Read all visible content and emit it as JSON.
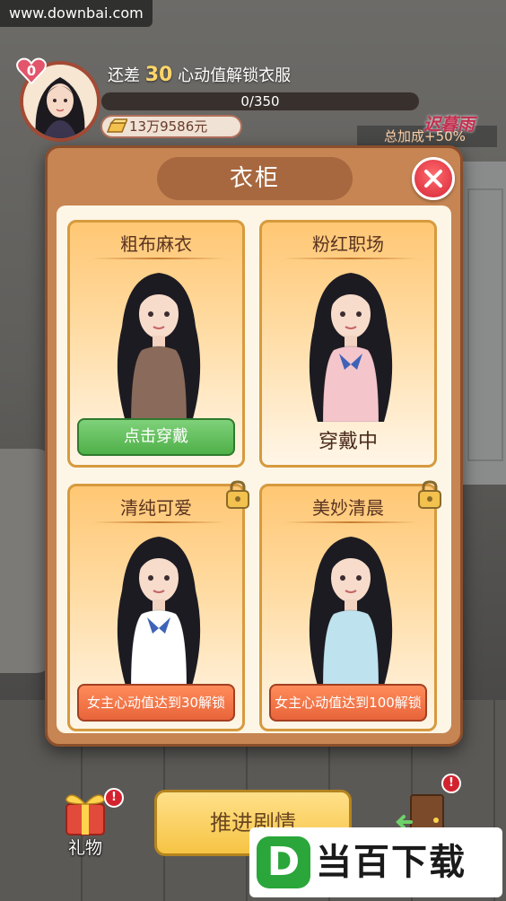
{
  "watermark_top": "www.downbai.com",
  "header": {
    "heart_level": "0",
    "unlock_prefix": "还差",
    "unlock_points": "30",
    "unlock_suffix": "心动值解锁衣服",
    "progress_text": "0/350",
    "progress_value": 0,
    "progress_max": 350,
    "money": "13万9586元",
    "character_name": "迟暮雨",
    "bonus_text": "总加成+50%"
  },
  "modal": {
    "title": "衣柜",
    "close_icon": "close-icon",
    "outfits": [
      {
        "title": "粗布麻衣",
        "status": "available",
        "button_label": "点击穿戴",
        "dress_color": "#8a6b5b"
      },
      {
        "title": "粉红职场",
        "status": "wearing",
        "status_label": "穿戴中",
        "dress_color": "#f4c6cb"
      },
      {
        "title": "清纯可爱",
        "status": "locked",
        "lock_label": "女主心动值达到30解锁",
        "dress_color": "#ffffff"
      },
      {
        "title": "美妙清晨",
        "status": "locked",
        "lock_label": "女主心动值达到100解锁",
        "dress_color": "#bfe3ee"
      }
    ]
  },
  "bottom": {
    "gift_label": "礼物",
    "gift_badge": "!",
    "advance_label": "推进剧情",
    "door_badge": "!"
  },
  "watermark_bottom": {
    "logo_letter": "D",
    "text": "当百下载"
  },
  "colors": {
    "modal_bg": "#c68553",
    "card_border": "#d69a3e",
    "green_button": "#4fb048",
    "orange_button": "#e8643a",
    "close_red": "#d6263a"
  }
}
